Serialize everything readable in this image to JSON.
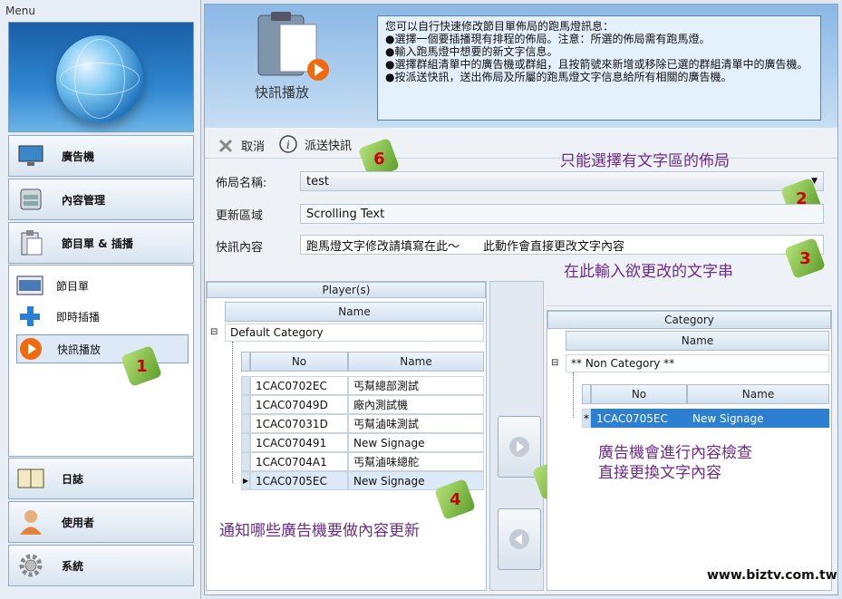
{
  "menu": {
    "title": "Menu",
    "items": [
      {
        "label": "廣告機",
        "icon": "monitor-icon"
      },
      {
        "label": "內容管理",
        "icon": "drawer-icon"
      },
      {
        "label": "節目單 & 插播",
        "icon": "clipboard-icon"
      }
    ],
    "subitems": [
      {
        "label": "節目單",
        "icon": "schedule-icon"
      },
      {
        "label": "即時插播",
        "icon": "plus-icon"
      },
      {
        "label": "快訊播放",
        "icon": "play-icon"
      }
    ],
    "bottom_items": [
      {
        "label": "日誌",
        "icon": "log-book-icon"
      },
      {
        "label": "使用者",
        "icon": "user-icon"
      },
      {
        "label": "系統",
        "icon": "gear-icon"
      }
    ]
  },
  "header": {
    "label": "快訊播放",
    "info_lines": [
      "您可以自行快速修改節目單佈局的跑馬燈訊息：",
      "●選擇一個要插播現有排程的佈局。注意：所選的佈局需有跑馬燈。",
      "●輸入跑馬燈中想要的新文字信息。",
      "●選擇群組清單中的廣告機或群組，且按箭號來新增或移除已選的群組清單中的廣告機。",
      "●按派送快訊，送出佈局及所屬的跑馬燈文字信息給所有相關的廣告機。"
    ]
  },
  "toolbar": {
    "cancel": "取消",
    "send": "派送快訊"
  },
  "form": {
    "layout_label": "佈局名稱:",
    "layout_value": "test",
    "region_label": "更新區域",
    "region_value": "Scrolling Text",
    "content_label": "快訊內容",
    "content_value": "跑馬燈文字修改請填寫在此～　　此動作會直接更改文字內容"
  },
  "players": {
    "title": "Player(s)",
    "name_header": "Name",
    "category": "Default Category",
    "col_no": "No",
    "col_name": "Name",
    "rows": [
      {
        "no": "1CAC0702EC",
        "name": "丐幫總部測試"
      },
      {
        "no": "1CAC07049D",
        "name": "廠內測試機"
      },
      {
        "no": "1CAC07031D",
        "name": "丐幫滷味測試"
      },
      {
        "no": "1CAC070491",
        "name": "New Signage"
      },
      {
        "no": "1CAC0704A1",
        "name": "丐幫滷味總舵"
      },
      {
        "no": "1CAC0705EC",
        "name": "New Signage"
      }
    ]
  },
  "category_panel": {
    "title": "Category",
    "name_header": "Name",
    "category": "** Non Category **",
    "col_no": "No",
    "col_name": "Name",
    "rows": [
      {
        "no": "1CAC0705EC",
        "name": "New Signage"
      }
    ]
  },
  "annotations": {
    "a1": "只能選擇有文字區的佈局",
    "a2": "在此輸入欲更改的文字串",
    "a3": "通知哪些廣告機要做內容更新",
    "a4": "廣告機會進行內容檢查",
    "a5": "直接更換文字內容",
    "watermark": "www.biztv.com.tw",
    "n1": "1",
    "n2": "2",
    "n3": "3",
    "n4": "4",
    "n5": "5",
    "n6": "6"
  },
  "colors": {
    "accent": "#2d7fd2",
    "annotation": "#6d2b8c",
    "badge": "#5d9e2a"
  }
}
